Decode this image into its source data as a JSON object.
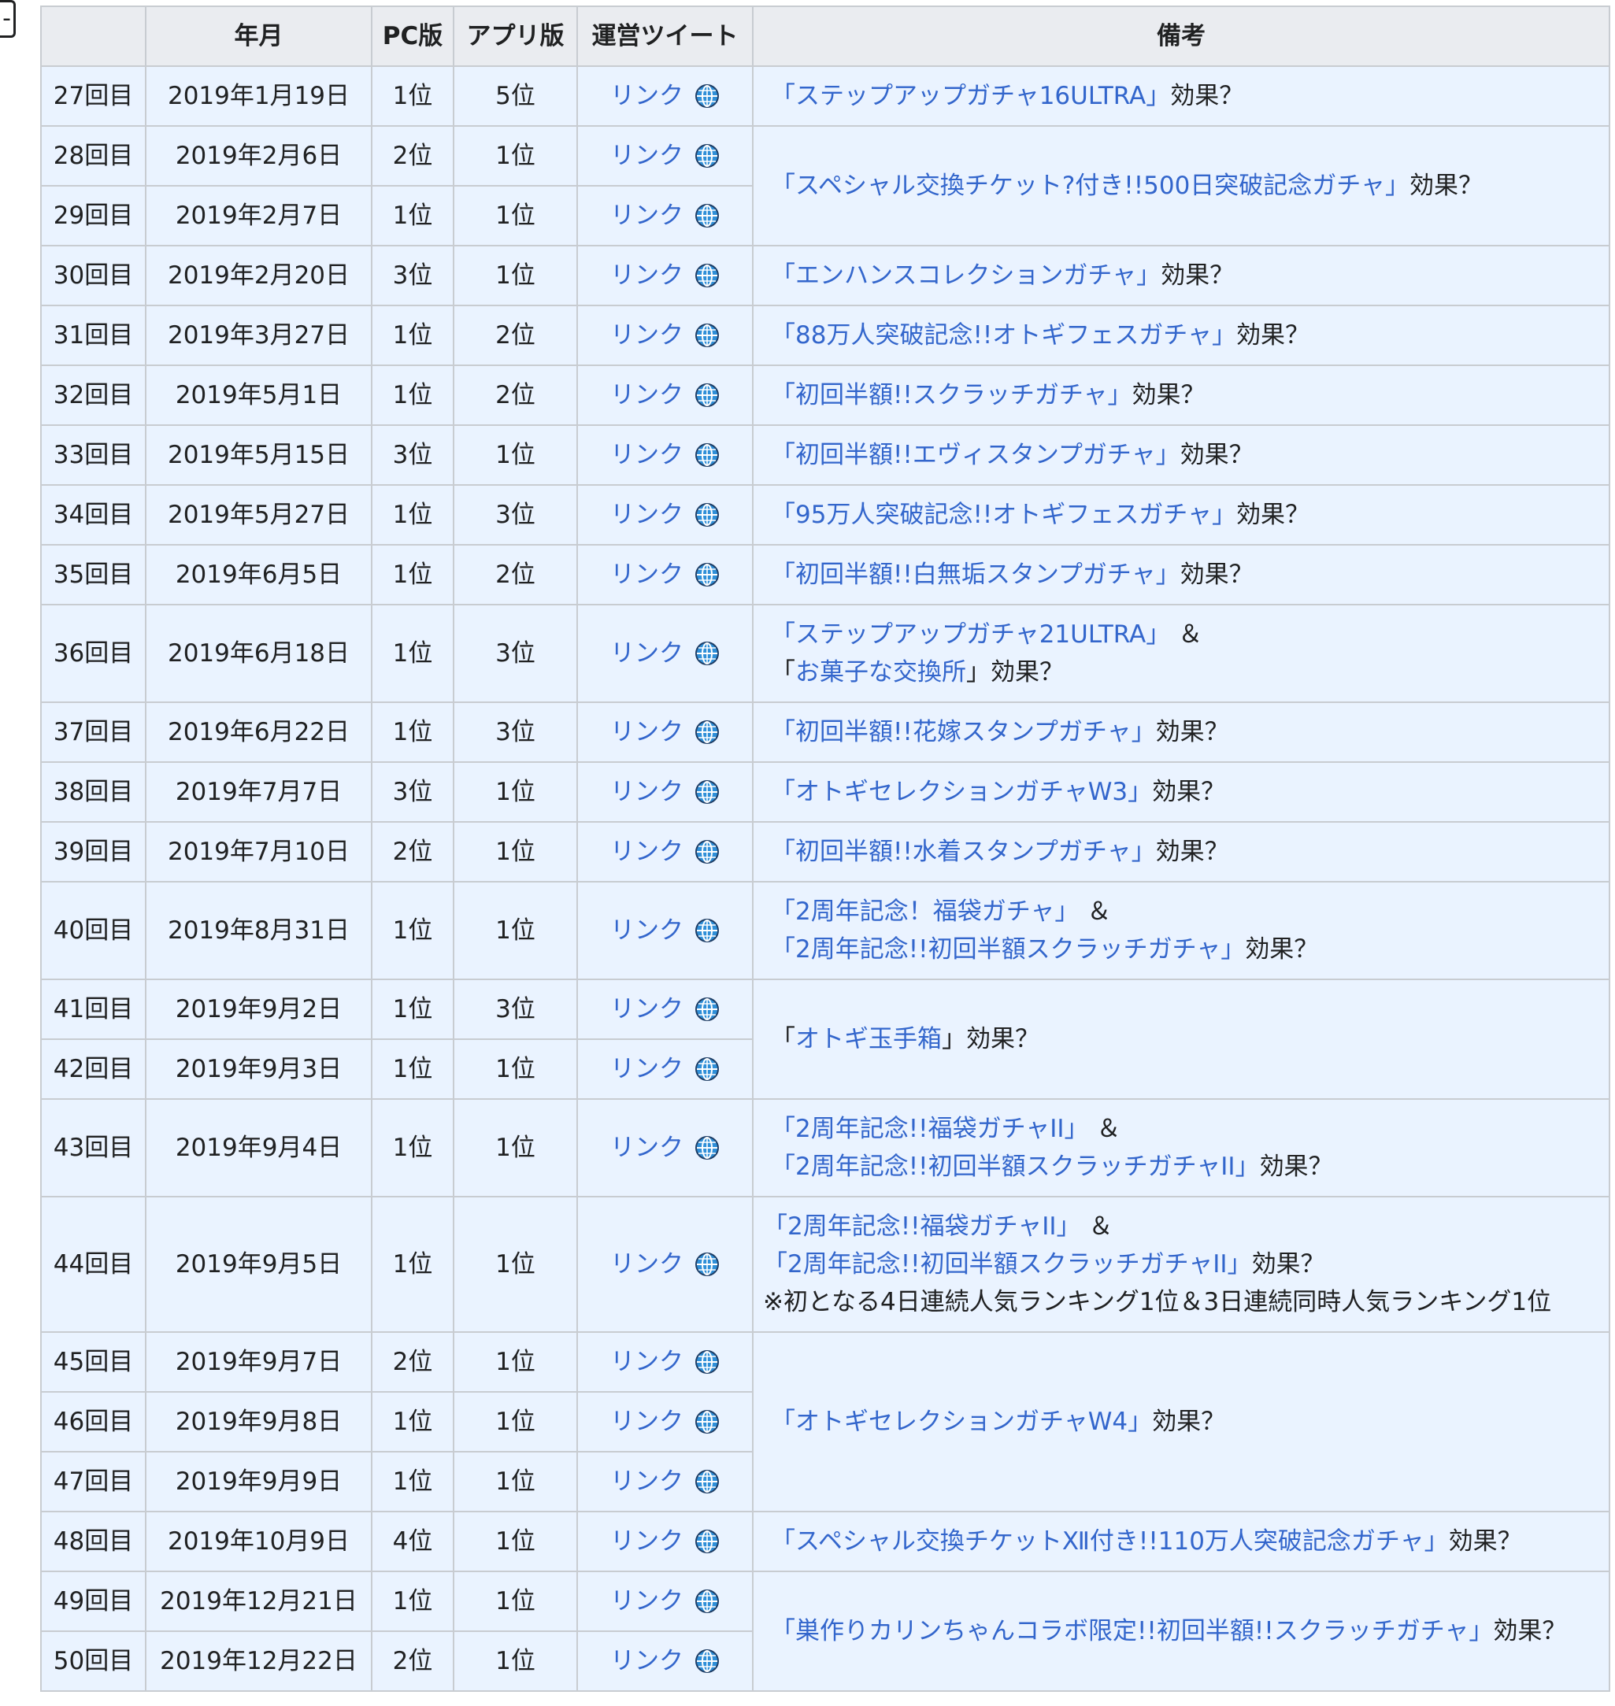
{
  "collapse_button": "-",
  "headers": [
    "",
    "年月",
    "PC版",
    "アプリ版",
    "運営ツイート",
    "備考"
  ],
  "link_label": "リンク",
  "note_suffix": "効果？",
  "amp": "＆",
  "rows": [
    {
      "no": "27回目",
      "date": "2019年1月19日",
      "pc": "1位",
      "app": "5位"
    },
    {
      "no": "28回目",
      "date": "2019年2月6日",
      "pc": "2位",
      "app": "1位"
    },
    {
      "no": "29回目",
      "date": "2019年2月7日",
      "pc": "1位",
      "app": "1位"
    },
    {
      "no": "30回目",
      "date": "2019年2月20日",
      "pc": "3位",
      "app": "1位"
    },
    {
      "no": "31回目",
      "date": "2019年3月27日",
      "pc": "1位",
      "app": "2位"
    },
    {
      "no": "32回目",
      "date": "2019年5月1日",
      "pc": "1位",
      "app": "2位"
    },
    {
      "no": "33回目",
      "date": "2019年5月15日",
      "pc": "3位",
      "app": "1位"
    },
    {
      "no": "34回目",
      "date": "2019年5月27日",
      "pc": "1位",
      "app": "3位"
    },
    {
      "no": "35回目",
      "date": "2019年6月5日",
      "pc": "1位",
      "app": "2位"
    },
    {
      "no": "36回目",
      "date": "2019年6月18日",
      "pc": "1位",
      "app": "3位"
    },
    {
      "no": "37回目",
      "date": "2019年6月22日",
      "pc": "1位",
      "app": "3位"
    },
    {
      "no": "38回目",
      "date": "2019年7月7日",
      "pc": "3位",
      "app": "1位"
    },
    {
      "no": "39回目",
      "date": "2019年7月10日",
      "pc": "2位",
      "app": "1位"
    },
    {
      "no": "40回目",
      "date": "2019年8月31日",
      "pc": "1位",
      "app": "1位"
    },
    {
      "no": "41回目",
      "date": "2019年9月2日",
      "pc": "1位",
      "app": "3位"
    },
    {
      "no": "42回目",
      "date": "2019年9月3日",
      "pc": "1位",
      "app": "1位"
    },
    {
      "no": "43回目",
      "date": "2019年9月4日",
      "pc": "1位",
      "app": "1位"
    },
    {
      "no": "44回目",
      "date": "2019年9月5日",
      "pc": "1位",
      "app": "1位"
    },
    {
      "no": "45回目",
      "date": "2019年9月7日",
      "pc": "2位",
      "app": "1位"
    },
    {
      "no": "46回目",
      "date": "2019年9月8日",
      "pc": "1位",
      "app": "1位"
    },
    {
      "no": "47回目",
      "date": "2019年9月9日",
      "pc": "1位",
      "app": "1位"
    },
    {
      "no": "48回目",
      "date": "2019年10月9日",
      "pc": "4位",
      "app": "1位"
    },
    {
      "no": "49回目",
      "date": "2019年12月21日",
      "pc": "1位",
      "app": "1位"
    },
    {
      "no": "50回目",
      "date": "2019年12月22日",
      "pc": "2位",
      "app": "1位"
    }
  ],
  "notes": {
    "n27": "「ステップアップガチャ16ULTRA」",
    "n28": "「スペシャル交換チケット?付き!!500日突破記念ガチャ」",
    "n30": "「エンハンスコレクションガチャ」",
    "n31": "「88万人突破記念!!オトギフェスガチャ」",
    "n32": "「初回半額!!スクラッチガチャ」",
    "n33": "「初回半額!!エヴィスタンプガチャ」",
    "n34": "「95万人突破記念!!オトギフェスガチャ」",
    "n35": "「初回半額!!白無垢スタンプガチャ」",
    "n36a": "「ステップアップガチャ21ULTRA」",
    "n36b_pre": "「",
    "n36b_link": "お菓子な交換所",
    "n36b_post": "」",
    "n37": "「初回半額!!花嫁スタンプガチャ」",
    "n38": "「オトギセレクションガチャW3」",
    "n39": "「初回半額!!水着スタンプガチャ」",
    "n40a": "「2周年記念！福袋ガチャ」",
    "n40b": "「2周年記念!!初回半額スクラッチガチャ」",
    "n41_pre": "「",
    "n41_link": "オトギ玉手箱",
    "n41_post": "」",
    "n43a": "「2周年記念!!福袋ガチャII」",
    "n43b": "「2周年記念!!初回半額スクラッチガチャII」",
    "n44a": "「2周年記念!!福袋ガチャII」",
    "n44b": "「2周年記念!!初回半額スクラッチガチャII」",
    "n44c": "※初となる4日連続人気ランキング1位＆3日連続同時人気ランキング1位",
    "n45": "「オトギセレクションガチャW4」",
    "n48": "「スペシャル交換チケットⅫ付き!!110万人突破記念ガチャ」",
    "n49": "「巣作りカリンちゃんコラボ限定!!初回半額!!スクラッチガチャ」"
  },
  "icons": {
    "link": "globe-icon"
  },
  "colors": {
    "link": "#3366cc",
    "header_bg": "#eaecf0",
    "cell_bg": "#eaf3ff",
    "border": "#c8ccd1"
  }
}
